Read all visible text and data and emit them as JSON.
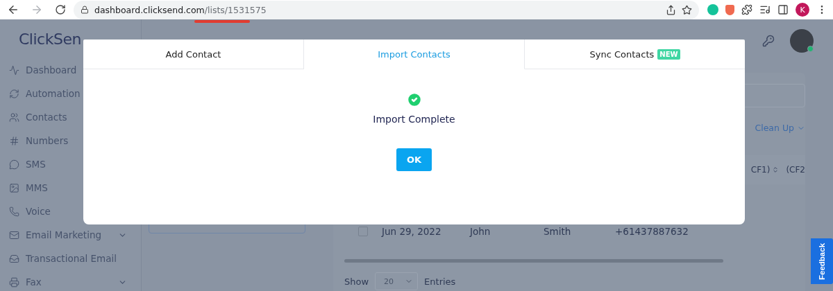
{
  "browser": {
    "url_host": "dashboard.clicksend.com",
    "url_path": "/lists/1531575",
    "forward_disabled": true,
    "profile_initial": "K"
  },
  "sidebar": {
    "logo": "ClickSen",
    "items": [
      {
        "label": "Dashboard",
        "has_submenu": false
      },
      {
        "label": "Automation",
        "has_submenu": false
      },
      {
        "label": "Contacts",
        "has_submenu": false
      },
      {
        "label": "Numbers",
        "has_submenu": false
      },
      {
        "label": "SMS",
        "has_submenu": false
      },
      {
        "label": "MMS",
        "has_submenu": false
      },
      {
        "label": "Voice",
        "has_submenu": false
      },
      {
        "label": "Email Marketing",
        "has_submenu": true
      },
      {
        "label": "Transactional Email",
        "has_submenu": false
      },
      {
        "label": "Fax",
        "has_submenu": true
      }
    ]
  },
  "contacts_panel": {
    "clean_up": "Clean Up",
    "columns": [
      {
        "label": "CF1)",
        "sortable": true
      },
      {
        "label": "(CF2",
        "sortable": false
      }
    ],
    "rows": [
      {
        "checked": false,
        "cells": [
          "Jun 29, 2022",
          "John",
          "Smith",
          "+61437887632"
        ]
      }
    ],
    "show_label": "Show",
    "page_size": "20",
    "entries_label": "Entries"
  },
  "feedback": "Feedback",
  "modal": {
    "tabs": [
      {
        "label": "Add Contact",
        "selected": false
      },
      {
        "label": "Import Contacts",
        "selected": true
      },
      {
        "label": "Sync Contacts",
        "selected": false,
        "badge": "NEW"
      }
    ],
    "message": "Import Complete",
    "ok": "OK"
  }
}
